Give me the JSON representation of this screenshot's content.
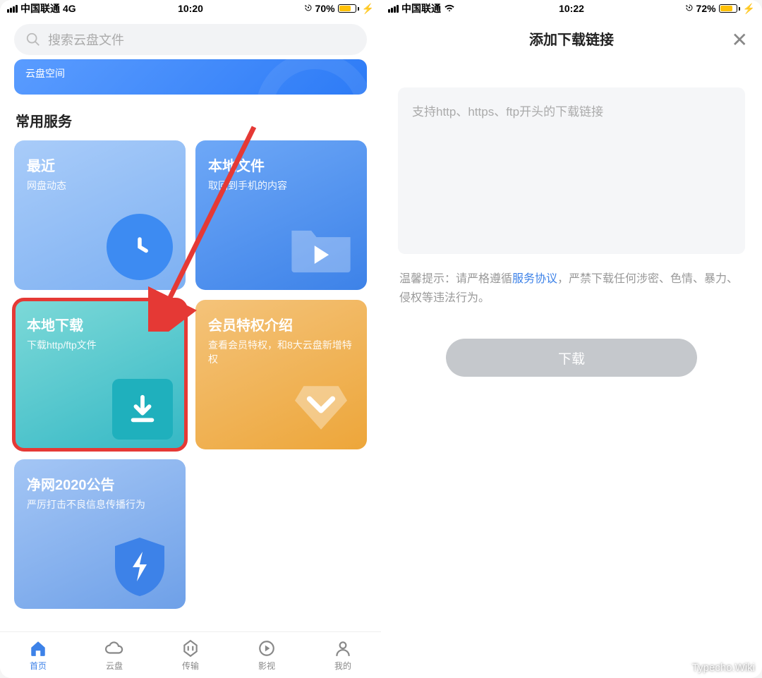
{
  "left": {
    "status": {
      "carrier": "中国联通",
      "network": "4G",
      "time": "10:20",
      "battery": "70%"
    },
    "search_placeholder": "搜索云盘文件",
    "banner": "云盘空间",
    "section_title": "常用服务",
    "cards": {
      "recent": {
        "title": "最近",
        "sub": "网盘动态"
      },
      "local": {
        "title": "本地文件",
        "sub": "取回到手机的内容"
      },
      "download": {
        "title": "本地下载",
        "sub": "下载http/ftp文件"
      },
      "vip": {
        "title": "会员特权介绍",
        "sub": "查看会员特权，和8大云盘新增特权"
      },
      "net": {
        "title": "净网2020公告",
        "sub": "严厉打击不良信息传播行为"
      }
    },
    "nav": {
      "home": "首页",
      "cloud": "云盘",
      "transfer": "传输",
      "media": "影视",
      "me": "我的"
    }
  },
  "right": {
    "status": {
      "carrier": "中国联通",
      "time": "10:22",
      "battery": "72%"
    },
    "header_title": "添加下载链接",
    "textarea_placeholder": "支持http、https、ftp开头的下载链接",
    "tip_prefix": "温馨提示：请严格遵循",
    "tip_link": "服务协议",
    "tip_suffix": "，严禁下载任何涉密、色情、暴力、侵权等违法行为。",
    "btn": "下载"
  },
  "watermark": "Typecho.Wiki"
}
